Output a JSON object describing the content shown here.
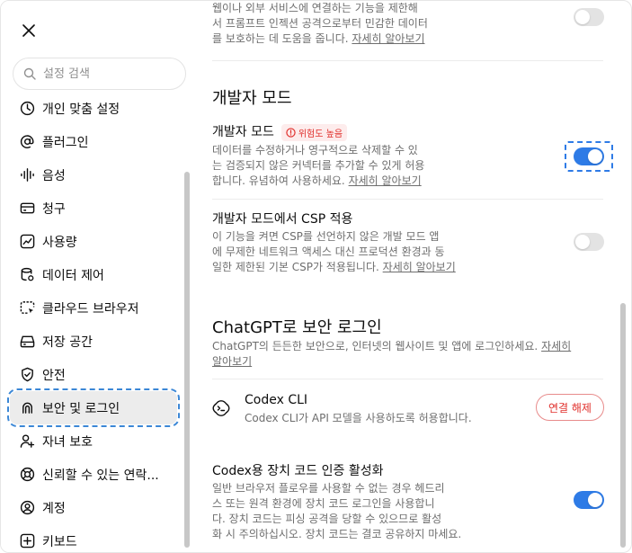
{
  "sidebar": {
    "search_placeholder": "설정 검색",
    "items": [
      {
        "label": "개인 맞춤 설정",
        "icon": "personalization-icon"
      },
      {
        "label": "플러그인",
        "icon": "at-sign-icon"
      },
      {
        "label": "음성",
        "icon": "waveform-icon"
      },
      {
        "label": "청구",
        "icon": "credit-card-icon"
      },
      {
        "label": "사용량",
        "icon": "chart-icon"
      },
      {
        "label": "데이터 제어",
        "icon": "database-icon"
      },
      {
        "label": "클라우드 브라우저",
        "icon": "cloud-browser-icon"
      },
      {
        "label": "저장 공간",
        "icon": "storage-icon"
      },
      {
        "label": "안전",
        "icon": "shield-icon"
      },
      {
        "label": "보안 및 로그인",
        "icon": "security-login-icon",
        "active": true
      },
      {
        "label": "자녀 보호",
        "icon": "parental-control-icon"
      },
      {
        "label": "신뢰할 수 있는 연락...",
        "icon": "trusted-contact-icon"
      },
      {
        "label": "계정",
        "icon": "account-icon"
      },
      {
        "label": "키보드",
        "icon": "keyboard-icon"
      }
    ]
  },
  "content": {
    "top_desc_lines": [
      "웹이나 외부 서비스에 연결하는 기능을 제한해",
      "서 프롬프트 인젝션 공격으로부터 민감한 데이터",
      "를 보호하는 데 도움을 줍니다."
    ],
    "learn_more": "자세히 알아보기",
    "dev_section_title": "개발자 모드",
    "dev_mode": {
      "title": "개발자 모드",
      "badge": "위험도 높음",
      "desc_lines": [
        "데이터를 수정하거나 영구적으로 삭제할 수 있",
        "는 검증되지 않은 커넥터를 추가할 수 있게 허용",
        "합니다. 유념하여 사용하세요."
      ],
      "enabled": true
    },
    "csp": {
      "title": "개발자 모드에서 CSP 적용",
      "desc_lines": [
        "이 기능을 켜면 CSP를 선언하지 않은 개발 모드 앱",
        "에 무제한 네트워크 액세스 대신 프로덕션 환경과 동",
        "일한 제한된 기본 CSP가 적용됩니다."
      ],
      "enabled": false
    },
    "login_section_title": "ChatGPT로 보안 로그인",
    "login_desc_line1": "ChatGPT의 든든한 보안으로, 인터넷의 웹사이트 및 앱에 로그인하세요.",
    "login_link_part1": "자세히",
    "login_link_part2": "알아보기",
    "codex_cli": {
      "title": "Codex CLI",
      "desc": "Codex CLI가 API 모델을 사용하도록 허용합니다.",
      "button": "연결 해제"
    },
    "device_code": {
      "title": "Codex용 장치 코드 인증 활성화",
      "desc_lines": [
        "일반 브라우저 플로우를 사용할 수 없는 경우 헤드리",
        "스 또는 원격 환경에 장치 코드 로그인을 사용합니",
        "다. 장치 코드는 피싱 공격을 당할 수 있으므로 활성",
        "화 시 주의하십시오. 장치 코드는 결코 공유하지 마세요."
      ],
      "enabled": true
    }
  },
  "colors": {
    "accent": "#2e7be6",
    "danger": "#e02e2a",
    "muted_text": "#6e6e6e",
    "focus_outline": "#3b87d6"
  }
}
